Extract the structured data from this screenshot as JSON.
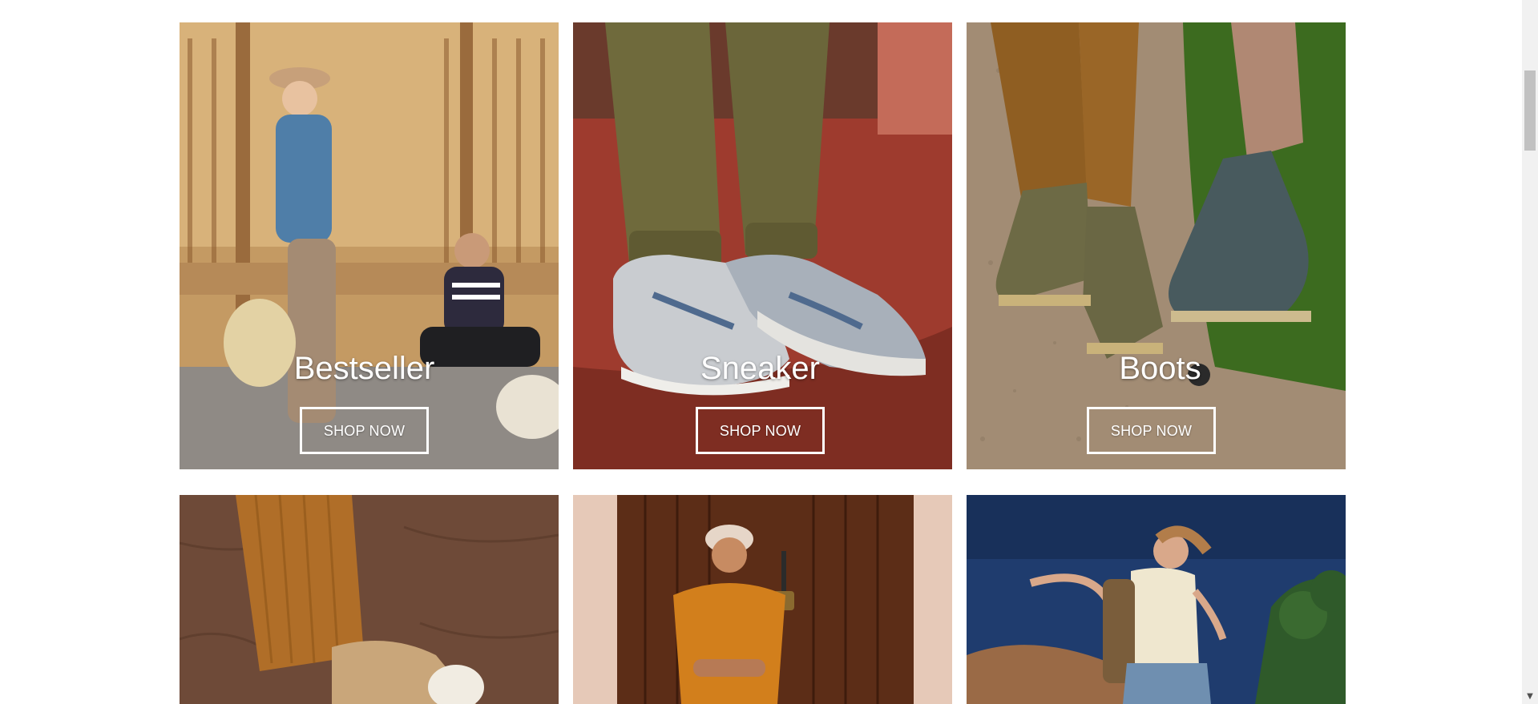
{
  "app": {
    "theme_colors": {
      "background": "#ffffff",
      "caption_text": "#ffffff",
      "button_border": "#ffffff",
      "scrollbar_track": "#f1f1f1",
      "scrollbar_thumb": "#c1c1c1"
    }
  },
  "categories": [
    {
      "title": "Bestseller",
      "button_label": "SHOP NOW",
      "image": "couple-seated-beach-hut-photo",
      "dominant_color": "#b48a5a"
    },
    {
      "title": "Sneaker",
      "button_label": "SHOP NOW",
      "image": "grey-sneakers-red-floor-photo",
      "dominant_color": "#a9493a"
    },
    {
      "title": "Boots",
      "button_label": "SHOP NOW",
      "image": "suede-boots-gravel-photo",
      "dominant_color": "#9c8670"
    }
  ],
  "categories_row2": [
    {
      "image": "corduroy-trousers-canvas-shoe-photo",
      "dominant_color": "#6e4a38"
    },
    {
      "image": "man-orange-tee-wooden-door-photo",
      "dominant_color": "#5a2e1b"
    },
    {
      "image": "woman-backpack-blue-sky-photo",
      "dominant_color": "#1f3c6e"
    }
  ],
  "scrollbar": {
    "down_arrow_icon": "chevron-down-icon"
  }
}
